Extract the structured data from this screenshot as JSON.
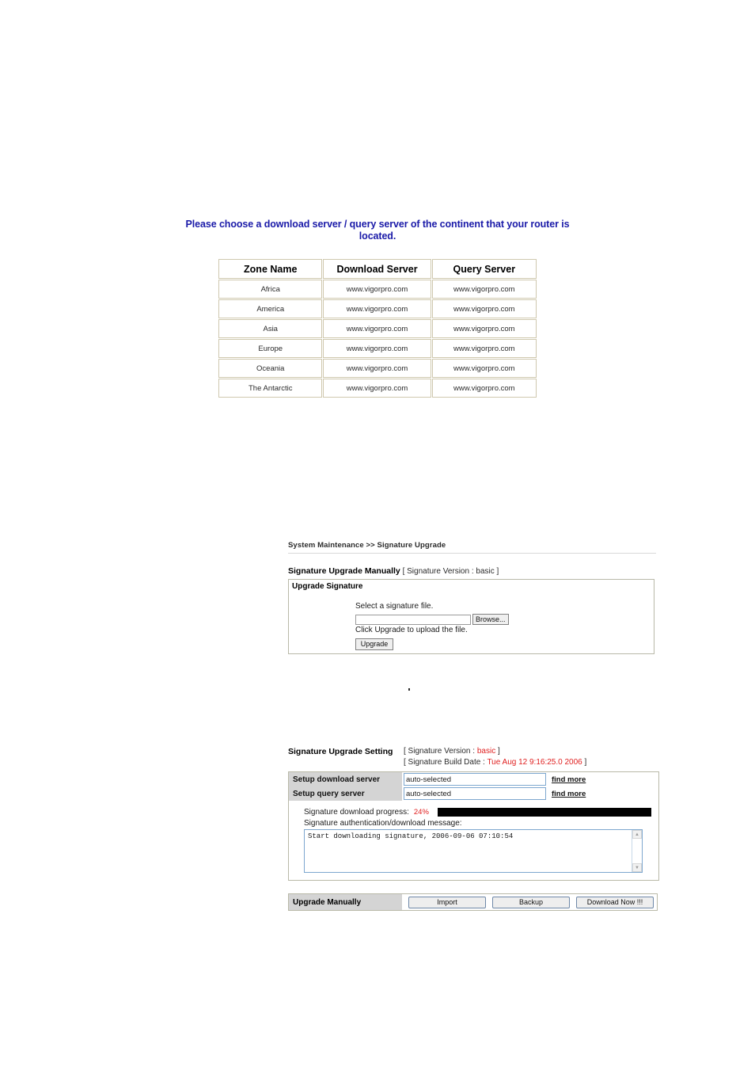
{
  "zone_section": {
    "heading": "Please choose a download server / query server of the continent that your router is located.",
    "table": {
      "columns": [
        "Zone Name",
        "Download Server",
        "Query Server"
      ],
      "rows": [
        [
          "Africa",
          "www.vigorpro.com",
          "www.vigorpro.com"
        ],
        [
          "America",
          "www.vigorpro.com",
          "www.vigorpro.com"
        ],
        [
          "Asia",
          "www.vigorpro.com",
          "www.vigorpro.com"
        ],
        [
          "Europe",
          "www.vigorpro.com",
          "www.vigorpro.com"
        ],
        [
          "Oceania",
          "www.vigorpro.com",
          "www.vigorpro.com"
        ],
        [
          "The Antarctic",
          "www.vigorpro.com",
          "www.vigorpro.com"
        ]
      ]
    }
  },
  "manual_upgrade": {
    "breadcrumb": "System Maintenance >> Signature Upgrade",
    "title": "Signature Upgrade Manually",
    "version_meta": "[ Signature Version : basic ]",
    "box_title": "Upgrade Signature",
    "select_file_label": "Select a signature file.",
    "file_value": "",
    "file_placeholder": "",
    "browse_label": "Browse...",
    "click_upgrade_label": "Click Upgrade to upload the file.",
    "upgrade_label": "Upgrade"
  },
  "upgrade_setting": {
    "title": "Signature Upgrade Setting",
    "version_prefix": "[ Signature Version : ",
    "version_value": "basic",
    "version_suffix": " ]",
    "build_date_prefix": "[ Signature Build Date : ",
    "build_date_value": "Tue Aug 12 9:16:25.0 2006",
    "build_date_suffix": " ]",
    "download_server_label": "Setup download server",
    "download_server_value": "auto-selected",
    "download_find_more": "find more",
    "query_server_label": "Setup query server",
    "query_server_value": "auto-selected",
    "query_find_more": "find more",
    "progress_label": "Signature download progress:",
    "progress_percent": "24%",
    "progress_value": 24,
    "message_label": "Signature authentication/download message:",
    "message_text": "Start downloading signature, 2006-09-06 07:10:54",
    "scroll_up_icon": "scroll-up-arrow",
    "scroll_down_icon": "scroll-down-arrow"
  },
  "action_bar": {
    "label": "Upgrade Manually",
    "buttons": [
      "Import",
      "Backup",
      "Download Now !!!"
    ]
  }
}
